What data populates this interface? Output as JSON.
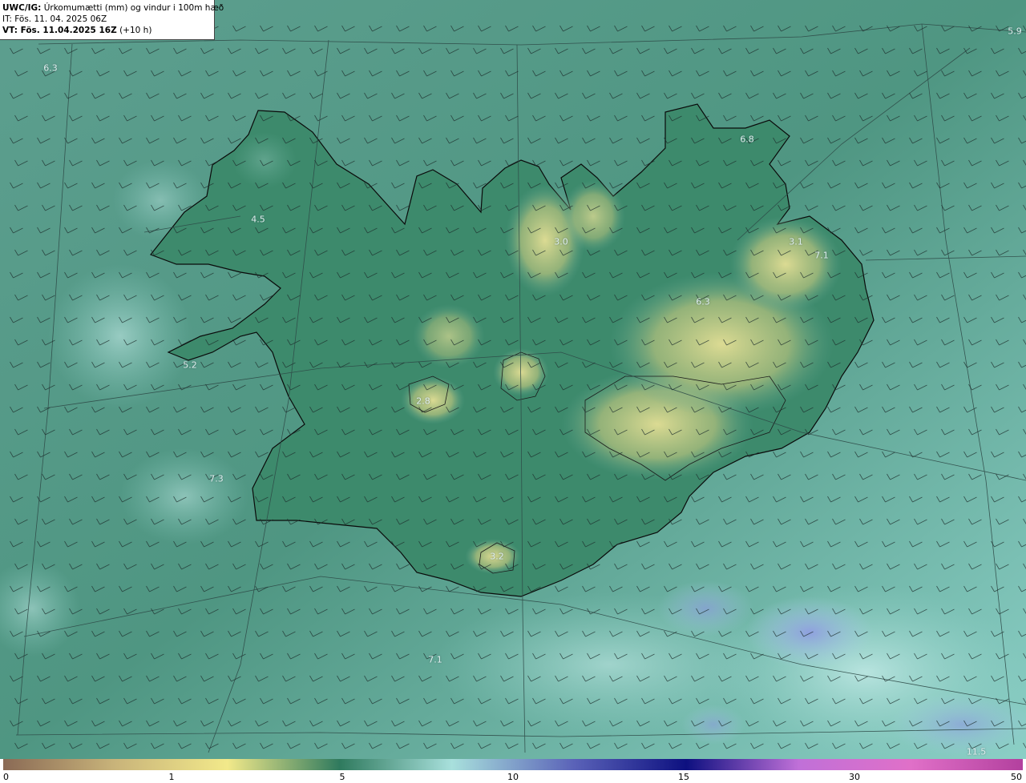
{
  "header": {
    "model_tag": "UWC/IG:",
    "title": "Úrkomumætti (mm) og vindur i 100m hæð",
    "init_time": "IT: Fös. 11. 04. 2025 06Z",
    "valid_prefix": "VT: Fös. 11.04.2025 16Z",
    "valid_suffix": "(+10 h)"
  },
  "value_labels": [
    {
      "text": "5.9"
    },
    {
      "text": "6.3"
    },
    {
      "text": "4.5"
    },
    {
      "text": "3.0"
    },
    {
      "text": "3.1"
    },
    {
      "text": "7.1"
    },
    {
      "text": "6.3"
    },
    {
      "text": "5.2"
    },
    {
      "text": "2.8"
    },
    {
      "text": "7.3"
    },
    {
      "text": "3.2"
    },
    {
      "text": "11.5"
    },
    {
      "text": "6.8"
    },
    {
      "text": "7.1"
    }
  ],
  "colorbar": {
    "ticks": [
      "0",
      "1",
      "5",
      "10",
      "15",
      "30",
      "50"
    ],
    "colors": [
      "#8a6a55",
      "#c9b47a",
      "#f2e98a",
      "#2f7a5e",
      "#a8e0dc",
      "#5a62b8",
      "#0d1080",
      "#c070d8",
      "#e070c8",
      "#b3409e"
    ]
  },
  "colors": {
    "ocean": "#5fa595",
    "land_wet": "#3f8a6e",
    "land_dry": "#d4d48a",
    "coast": "#0a0a0a",
    "graticule": "#2e4a47",
    "barb": "#1e2e2c"
  }
}
